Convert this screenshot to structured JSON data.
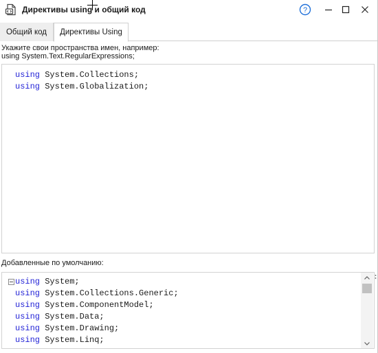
{
  "window": {
    "title": "Директивы using и общий код"
  },
  "titlebar_buttons": {
    "help": "?",
    "help_icon": "help-circle-icon",
    "minimize_icon": "minimize-icon",
    "maximize_icon": "maximize-icon",
    "close_icon": "close-icon"
  },
  "tabs": [
    {
      "label": "Общий код",
      "active": false
    },
    {
      "label": "Директивы Using",
      "active": true
    }
  ],
  "hint": {
    "line1": "Укажите свои пространства имен, например:",
    "line2": "using System.Text.RegularExpressions;"
  },
  "user_editor": {
    "lines": [
      {
        "kw": "using",
        "rest": " System.Collections;"
      },
      {
        "kw": "using",
        "rest": " System.Globalization;"
      }
    ]
  },
  "default_label": "Добавленные по умолчанию:",
  "default_editor": {
    "lines": [
      {
        "kw": "using",
        "rest": " System;"
      },
      {
        "kw": "using",
        "rest": " System.Collections.Generic;"
      },
      {
        "kw": "using",
        "rest": " System.ComponentModel;"
      },
      {
        "kw": "using",
        "rest": " System.Data;"
      },
      {
        "kw": "using",
        "rest": " System.Drawing;"
      },
      {
        "kw": "using",
        "rest": " System.Linq;"
      }
    ]
  },
  "colors": {
    "keyword": "#1f1fd6",
    "help_icon": "#1e6fd9"
  }
}
